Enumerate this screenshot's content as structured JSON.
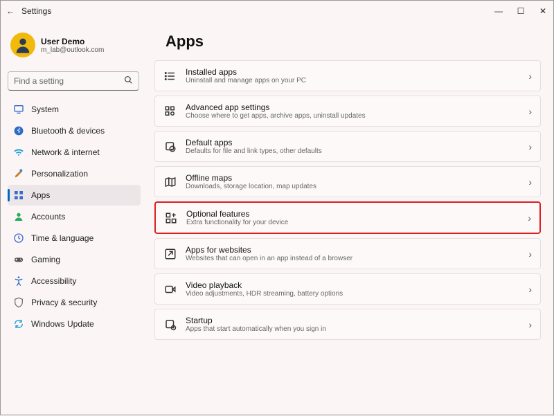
{
  "titlebar": {
    "back": "←",
    "title": "Settings",
    "min": "—",
    "max": "☐",
    "close": "✕"
  },
  "profile": {
    "name": "User Demo",
    "email": "m_lab@outlook.com"
  },
  "search": {
    "placeholder": "Find a setting"
  },
  "nav": {
    "items": [
      {
        "label": "System"
      },
      {
        "label": "Bluetooth & devices"
      },
      {
        "label": "Network & internet"
      },
      {
        "label": "Personalization"
      },
      {
        "label": "Apps"
      },
      {
        "label": "Accounts"
      },
      {
        "label": "Time & language"
      },
      {
        "label": "Gaming"
      },
      {
        "label": "Accessibility"
      },
      {
        "label": "Privacy & security"
      },
      {
        "label": "Windows Update"
      }
    ]
  },
  "page": {
    "title": "Apps"
  },
  "cards": [
    {
      "title": "Installed apps",
      "sub": "Uninstall and manage apps on your PC"
    },
    {
      "title": "Advanced app settings",
      "sub": "Choose where to get apps, archive apps, uninstall updates"
    },
    {
      "title": "Default apps",
      "sub": "Defaults for file and link types, other defaults"
    },
    {
      "title": "Offline maps",
      "sub": "Downloads, storage location, map updates"
    },
    {
      "title": "Optional features",
      "sub": "Extra functionality for your device"
    },
    {
      "title": "Apps for websites",
      "sub": "Websites that can open in an app instead of a browser"
    },
    {
      "title": "Video playback",
      "sub": "Video adjustments, HDR streaming, battery options"
    },
    {
      "title": "Startup",
      "sub": "Apps that start automatically when you sign in"
    }
  ]
}
